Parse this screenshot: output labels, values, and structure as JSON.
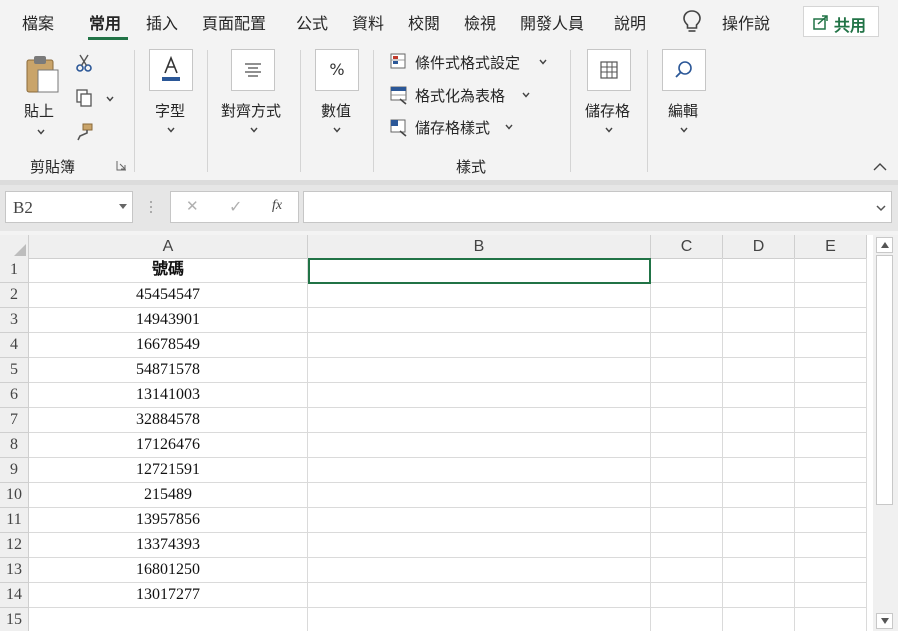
{
  "tabs": [
    {
      "label": "檔案"
    },
    {
      "label": "常用"
    },
    {
      "label": "插入"
    },
    {
      "label": "頁面配置"
    },
    {
      "label": "公式"
    },
    {
      "label": "資料"
    },
    {
      "label": "校閱"
    },
    {
      "label": "檢視"
    },
    {
      "label": "開發人員"
    },
    {
      "label": "說明"
    }
  ],
  "active_tab": "常用",
  "tell_me": "操作說",
  "share": {
    "label": "共用",
    "icon": "share-icon"
  },
  "ribbon": {
    "clipboard": {
      "paste_label": "貼上",
      "group_label": "剪貼簿",
      "icons": [
        "paste-icon",
        "cut-icon",
        "copy-icon",
        "format-painter-icon",
        "dialog-launcher-icon"
      ]
    },
    "font": {
      "label": "字型",
      "icon": "font-color-icon"
    },
    "alignment": {
      "label": "對齊方式",
      "icon": "align-center-icon"
    },
    "number": {
      "label": "數值",
      "icon_text": "%"
    },
    "styles": {
      "conditional_formatting": "條件式格式設定",
      "format_as_table": "格式化為表格",
      "cell_styles": "儲存格樣式",
      "group_label": "樣式"
    },
    "cells": {
      "label": "儲存格",
      "icon": "cells-icon"
    },
    "editing": {
      "label": "編輯",
      "icon": "search-icon"
    }
  },
  "formula_bar": {
    "name_box": "B2",
    "cancel_glyph": "✕",
    "enter_glyph": "✓",
    "fx_label": "fx",
    "formula": ""
  },
  "sheet": {
    "columns": [
      "A",
      "B",
      "C",
      "D",
      "E"
    ],
    "rows": [
      {
        "num": "1",
        "a": "號碼"
      },
      {
        "num": "2",
        "a": "45454547"
      },
      {
        "num": "3",
        "a": "14943901"
      },
      {
        "num": "4",
        "a": "16678549"
      },
      {
        "num": "5",
        "a": "54871578"
      },
      {
        "num": "6",
        "a": "13141003"
      },
      {
        "num": "7",
        "a": "32884578"
      },
      {
        "num": "8",
        "a": "17126476"
      },
      {
        "num": "9",
        "a": "12721591"
      },
      {
        "num": "10",
        "a": "215489"
      },
      {
        "num": "11",
        "a": "13957856"
      },
      {
        "num": "12",
        "a": "13374393"
      },
      {
        "num": "13",
        "a": "16801250"
      },
      {
        "num": "14",
        "a": "13017277"
      },
      {
        "num": "15",
        "a": ""
      }
    ],
    "selected_cell": "B2"
  }
}
